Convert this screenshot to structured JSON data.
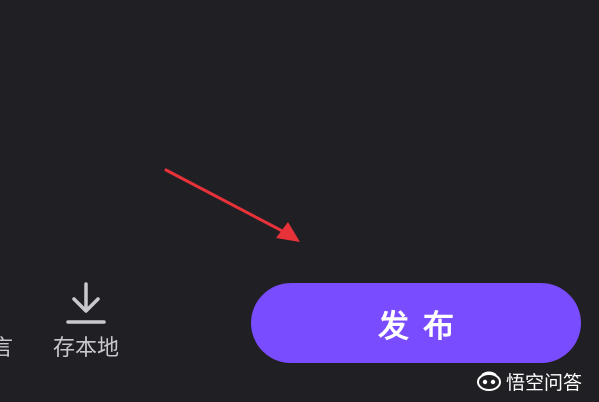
{
  "left_partial_label": "言",
  "save_local": {
    "label": "存本地",
    "icon": "download-icon"
  },
  "publish_button": {
    "label": "发布",
    "color": "#7a4cff"
  },
  "annotation": {
    "icon": "red-arrow-icon",
    "color": "#e8323a"
  },
  "watermark": {
    "text": "悟空问答",
    "icon": "wukong-logo-icon"
  },
  "colors": {
    "background": "#201f24",
    "text_light": "#c9c9cd"
  }
}
